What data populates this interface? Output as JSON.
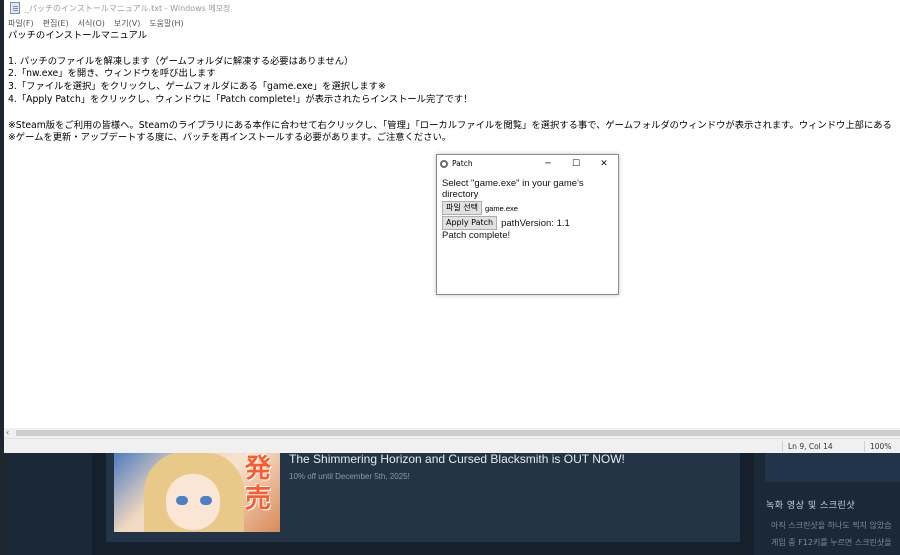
{
  "notepad": {
    "title": "_パッチのインストールマニュアル.txt - Windows 메모장",
    "menu": [
      "파일(F)",
      "편집(E)",
      "서식(O)",
      "보기(V)",
      "도움말(H)"
    ],
    "lines": [
      "パッチのインストールマニュアル",
      "",
      "1. パッチのファイルを解凍します（ゲームフォルダに解凍する必要はありません）",
      "2.「nw.exe」を開き、ウィンドウを呼び出します",
      "3.「ファイルを選択」をクリックし、ゲームフォルダにある「game.exe」を選択します※",
      "4.「Apply Patch」をクリックし、ウィンドウに「Patch complete!」が表示されたらインストール完了です！",
      "",
      "※Steam版をご利用の皆様へ。Steamのライブラリにある本作に合わせて右クリックし、「管理」「ローカルファイルを閲覧」を選択する事で、ゲームフォルダのウィンドウが表示されます。ウィンドウ上部にある",
      "※ゲームを更新・アップデートする度に、パッチを再インストールする必要があります。ご注意ください。"
    ],
    "status": {
      "position": "Ln 9, Col 14",
      "zoom": "100%"
    }
  },
  "patch_dialog": {
    "title": "Patch",
    "instruction": "Select \"game.exe\" in your game's directory",
    "file_button": "파일 선택",
    "file_name": "game.exe",
    "apply_button": "Apply Patch",
    "version": "pathVersion: 1.1",
    "result": "Patch complete!"
  },
  "background": {
    "banner_text": "発売",
    "news_title": "The Shimmering Horizon and Cursed Blacksmith is OUT NOW!",
    "news_sub": "10% off until December 5th, 2025!",
    "right_heading": "녹화 영상 및 스크린샷",
    "right_line1": "아직 스크린샷을 하나도 찍지 않았습",
    "right_line2": "게임 중 F12키를 누르면 스크린샷을"
  }
}
